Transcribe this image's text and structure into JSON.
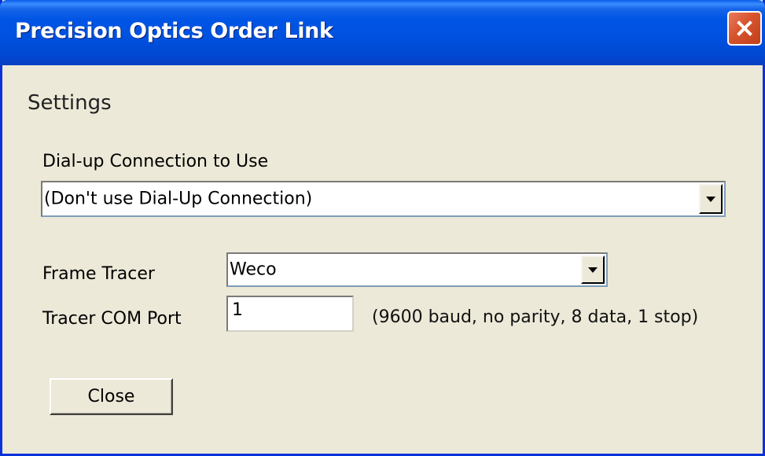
{
  "window": {
    "title": "Precision Optics Order Link",
    "close_icon": "close-icon"
  },
  "settings": {
    "heading": "Settings",
    "dialup": {
      "label": "Dial-up Connection to Use",
      "selected": "(Don't use Dial-Up Connection)",
      "arrow_icon": "chevron-down-icon"
    },
    "frame_tracer": {
      "label": "Frame Tracer",
      "selected": "Weco",
      "arrow_icon": "chevron-down-icon"
    },
    "com_port": {
      "label": "Tracer COM Port",
      "value": "1",
      "hint": "(9600 baud, no parity, 8 data, 1 stop)"
    },
    "close_label": "Close"
  },
  "colors": {
    "titlebar": "#0055e5",
    "face": "#ece9d8",
    "close_button": "#d6532c"
  }
}
